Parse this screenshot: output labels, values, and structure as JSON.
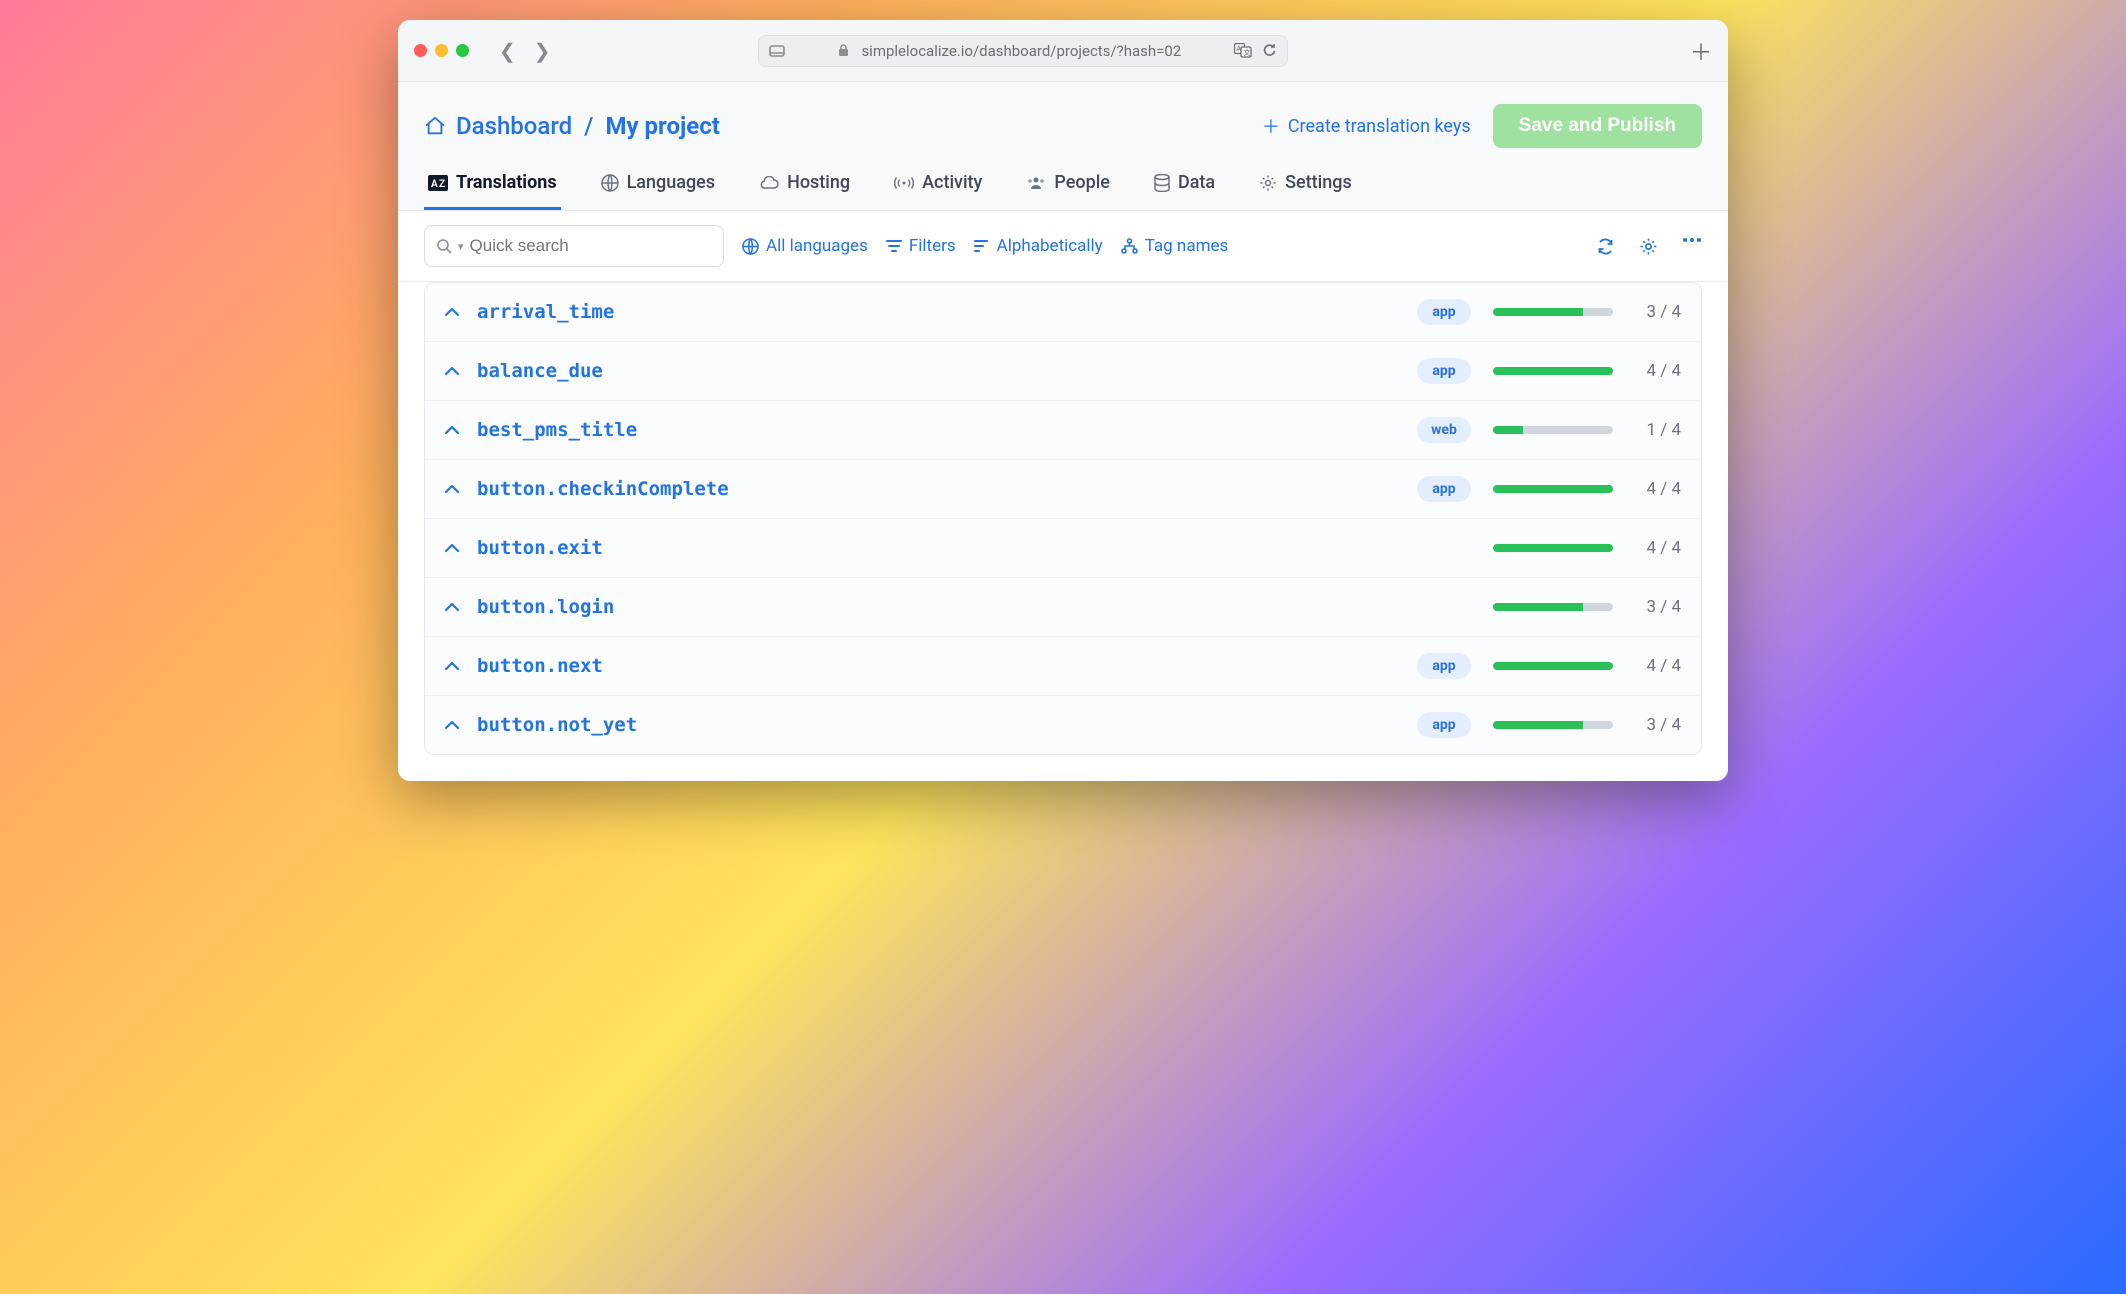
{
  "browser": {
    "url": "simplelocalize.io/dashboard/projects/?hash=02"
  },
  "breadcrumb": {
    "root": "Dashboard",
    "separator": "/",
    "current": "My project"
  },
  "header": {
    "create_label": "Create translation keys",
    "publish_label": "Save and Publish"
  },
  "tabs": [
    {
      "label": "Translations"
    },
    {
      "label": "Languages"
    },
    {
      "label": "Hosting"
    },
    {
      "label": "Activity"
    },
    {
      "label": "People"
    },
    {
      "label": "Data"
    },
    {
      "label": "Settings"
    }
  ],
  "toolbar": {
    "search_placeholder": "Quick search",
    "all_languages": "All languages",
    "filters": "Filters",
    "sort": "Alphabetically",
    "tag_names": "Tag names"
  },
  "keys": [
    {
      "name": "arrival_time",
      "tag": "app",
      "done": 3,
      "total": 4
    },
    {
      "name": "balance_due",
      "tag": "app",
      "done": 4,
      "total": 4
    },
    {
      "name": "best_pms_title",
      "tag": "web",
      "done": 1,
      "total": 4
    },
    {
      "name": "button.checkinComplete",
      "tag": "app",
      "done": 4,
      "total": 4
    },
    {
      "name": "button.exit",
      "tag": "",
      "done": 4,
      "total": 4
    },
    {
      "name": "button.login",
      "tag": "",
      "done": 3,
      "total": 4
    },
    {
      "name": "button.next",
      "tag": "app",
      "done": 4,
      "total": 4
    },
    {
      "name": "button.not_yet",
      "tag": "app",
      "done": 3,
      "total": 4
    }
  ]
}
